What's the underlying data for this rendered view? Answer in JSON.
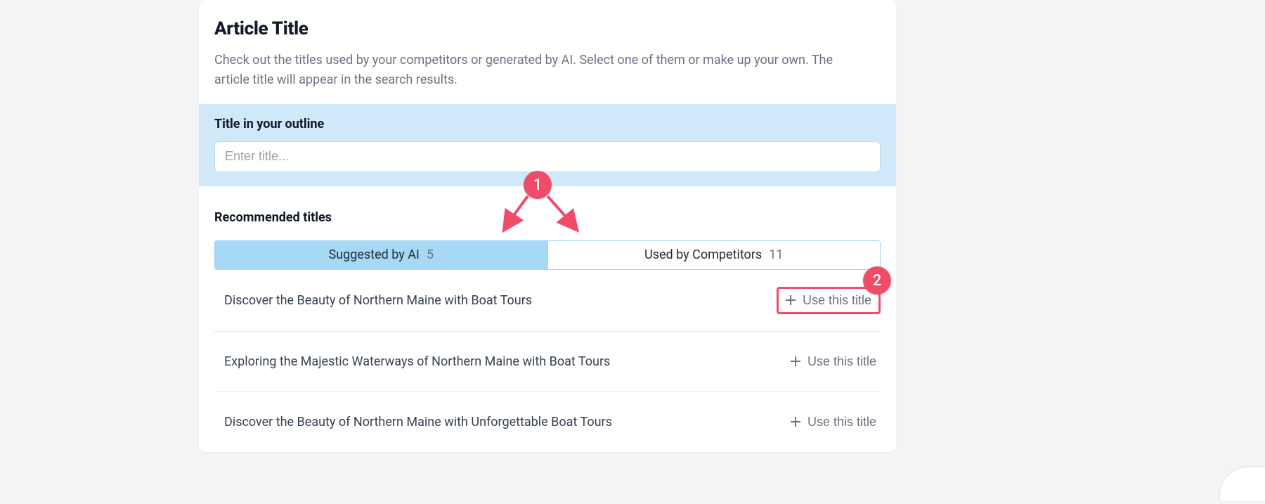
{
  "header": {
    "title": "Article Title",
    "description": "Check out the titles used by your competitors or generated by AI. Select one of them or make up your own. The article title will appear in the search results."
  },
  "outline": {
    "label": "Title in your outline",
    "placeholder": "Enter title..."
  },
  "recommended": {
    "heading": "Recommended titles",
    "tabs": [
      {
        "label": "Suggested by AI",
        "count": "5",
        "active": true
      },
      {
        "label": "Used by Competitors",
        "count": "11",
        "active": false
      }
    ],
    "use_label": "Use this title",
    "items": [
      "Discover the Beauty of Northern Maine with Boat Tours",
      "Exploring the Majestic Waterways of Northern Maine with Boat Tours",
      "Discover the Beauty of Northern Maine with Unforgettable Boat Tours"
    ]
  },
  "annotations": {
    "badge1": "1",
    "badge2": "2",
    "arrow_color": "#ef4c6a"
  }
}
